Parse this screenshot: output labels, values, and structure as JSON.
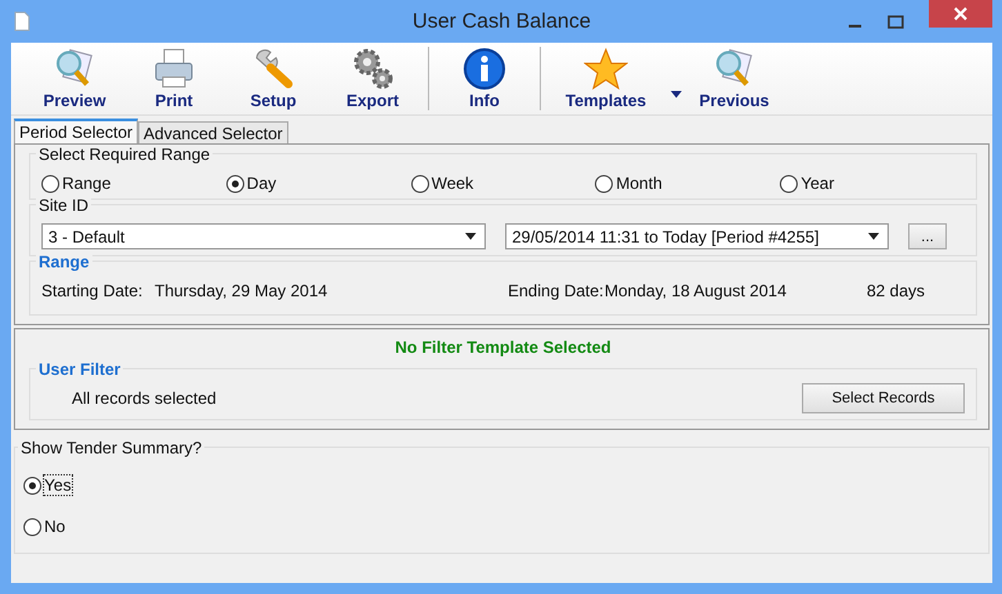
{
  "window": {
    "title": "User Cash Balance"
  },
  "toolbar": [
    {
      "label": "Preview",
      "kind": "preview",
      "dropdown": false
    },
    {
      "label": "Print",
      "kind": "print",
      "dropdown": false
    },
    {
      "label": "Setup",
      "kind": "setup",
      "dropdown": false
    },
    {
      "label": "Export",
      "kind": "export",
      "dropdown": false
    },
    {
      "kind": "separator"
    },
    {
      "label": "Info",
      "kind": "info",
      "dropdown": false
    },
    {
      "kind": "separator"
    },
    {
      "label": "Templates",
      "kind": "templates",
      "dropdown": true
    },
    {
      "label": "Previous",
      "kind": "preview",
      "dropdown": false
    }
  ],
  "tabs": [
    {
      "label": "Period Selector",
      "selected": true
    },
    {
      "label": "Advanced Selector",
      "selected": false
    }
  ],
  "range_group": {
    "title": "Select Required Range",
    "options": [
      {
        "label": "Range",
        "selected": false
      },
      {
        "label": "Day",
        "selected": true
      },
      {
        "label": "Week",
        "selected": false
      },
      {
        "label": "Month",
        "selected": false
      },
      {
        "label": "Year",
        "selected": false
      }
    ]
  },
  "site_group": {
    "title": "Site ID",
    "site": "3 - Default",
    "period": "29/05/2014 11:31 to Today [Period #4255]",
    "browse_button": "..."
  },
  "range_info": {
    "title": "Range",
    "starting_label": "Starting Date:",
    "starting_value": "Thursday, 29 May 2014",
    "ending_label": "Ending Date:",
    "ending_value": "Monday, 18 August 2014",
    "days": "82 days"
  },
  "filter": {
    "status": "No Filter Template Selected",
    "title": "User Filter",
    "summary": "All records selected",
    "button": "Select Records"
  },
  "tender": {
    "title": "Show Tender Summary?",
    "options": [
      {
        "label": "Yes",
        "selected": true
      },
      {
        "label": "No",
        "selected": false
      }
    ]
  }
}
